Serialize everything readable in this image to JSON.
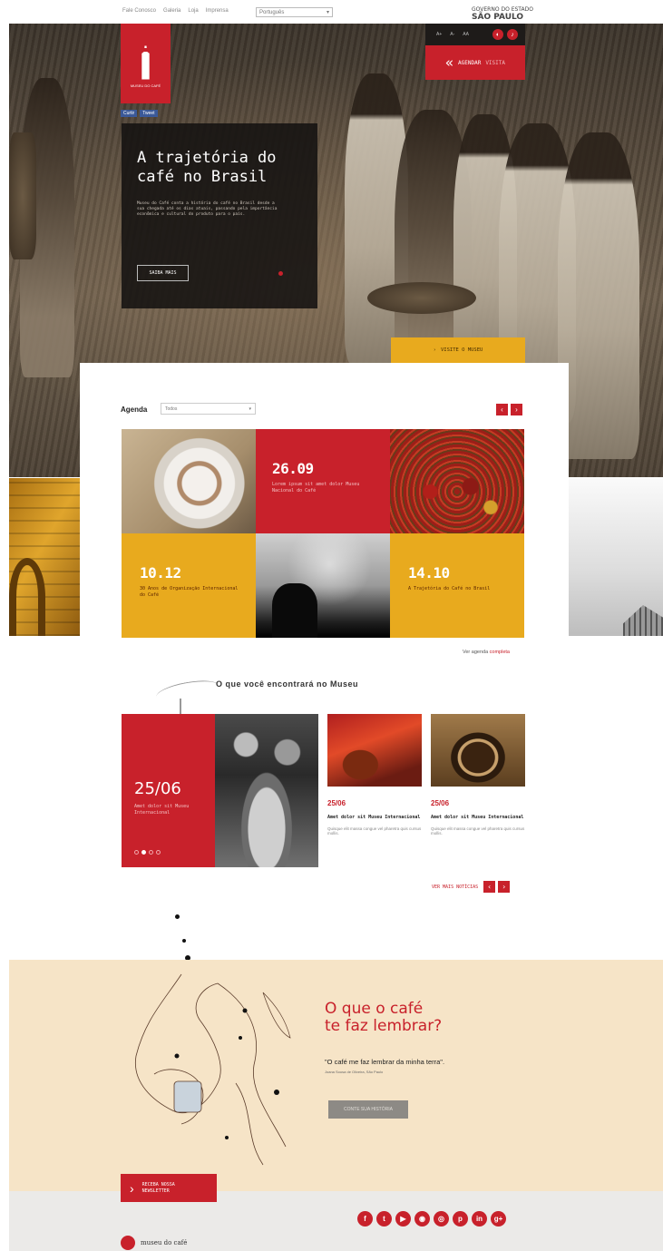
{
  "topbar": {
    "nav": [
      "Fale Conosco",
      "Galeria",
      "Loja",
      "Imprensa"
    ],
    "language": "Português",
    "brand": "SÃO PAULO",
    "brand_sub": "GOVERNO DO ESTADO"
  },
  "hero": {
    "title": "A trajetória do café no Brasil",
    "body": "Museu do Café conta a história do café no Brasil desde a sua chegada até os dias atuais, passando pela importância econômica e cultural do produto para o país.",
    "more_label": "SAIBA MAIS",
    "share": [
      "Curtir",
      "Tweet"
    ]
  },
  "logo": {
    "text": "MUSEU DO CAFÉ"
  },
  "access": {
    "items": [
      "A+",
      "A-",
      "AA"
    ],
    "icons": [
      "contrast-icon",
      "audio-icon"
    ]
  },
  "agir": {
    "label": "AGENDAR",
    "label2": "VISITA"
  },
  "visit": {
    "label": "VISITE O MUSEU"
  },
  "agenda": {
    "label": "Agenda",
    "select": "Todos",
    "more_prefix": "Ver agenda",
    "more_link": "completa",
    "tiles": [
      {
        "date": "26.09",
        "caption": "Lorem ipsum sit amet dolor Museu Nacional do Café"
      },
      {
        "date": "10.12",
        "caption": "30 Anos de Organização Internacional do Café"
      },
      {
        "date": "14.10",
        "caption": "A Trajetória do Café no Brasil"
      }
    ]
  },
  "discover": {
    "title": "O que você encontrará no Museu",
    "featured": {
      "date": "25/06",
      "caption": "Amet dolor sit Museu Internacional"
    },
    "news": [
      {
        "date": "25/06",
        "title": "Amet dolor sit Museu Internacional",
        "summary": "Quisque elit massa congue vel pharetra quis cursus mollis."
      },
      {
        "date": "25/06",
        "title": "Amet dolor sit Museu Internacional",
        "summary": "Quisque elit massa congue vel pharetra quis cursus mollis."
      }
    ],
    "more_label": "VER MAIS NOTÍCIAS"
  },
  "remember": {
    "title_line1": "O que o café",
    "title_line2": "te faz lembrar?",
    "quote": "\"O café me faz lembrar da minha terra\".",
    "author": "Joana Sousa de Oliveira, São Paulo",
    "button": "CONTE SUA HISTÓRIA"
  },
  "footer": {
    "newsletter_line1": "RECEBA NOSSA",
    "newsletter_line2": "NEWSLETTER",
    "social": [
      "f",
      "t",
      "▶",
      "◉",
      "◎",
      "p",
      "in",
      "g+"
    ],
    "brand": "museu do café"
  },
  "colors": {
    "red": "#c8212b",
    "yellow": "#e8aa1e",
    "cream": "#f6e4c7"
  }
}
